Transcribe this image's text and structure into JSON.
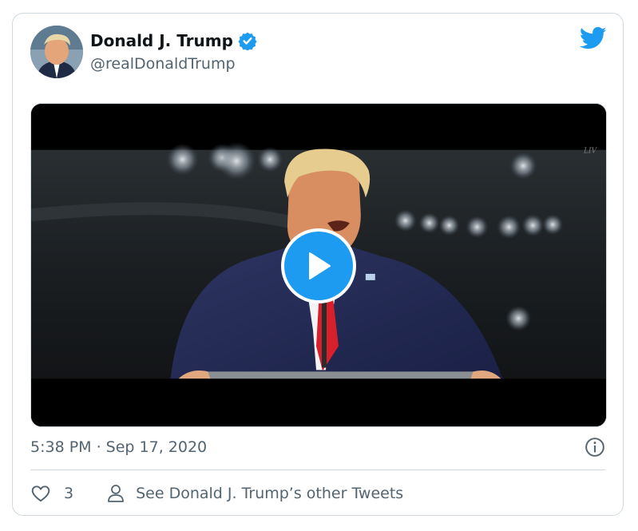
{
  "tweet": {
    "display_name": "Donald J. Trump",
    "handle": "@realDonaldTrump",
    "timestamp": "5:38 PM · Sep 17, 2020",
    "like_count": "3",
    "profile_link": "See Donald J. Trump’s other Tweets"
  },
  "colors": {
    "brand": "#1d9bf0",
    "text": "#0f1419",
    "secondary_text": "#536471",
    "border": "#cfd9de"
  },
  "icons": {
    "logo": "twitter-bird-icon",
    "verified": "verified-badge-icon",
    "play": "play-icon",
    "info": "info-icon",
    "like": "heart-icon",
    "profile": "person-icon"
  }
}
